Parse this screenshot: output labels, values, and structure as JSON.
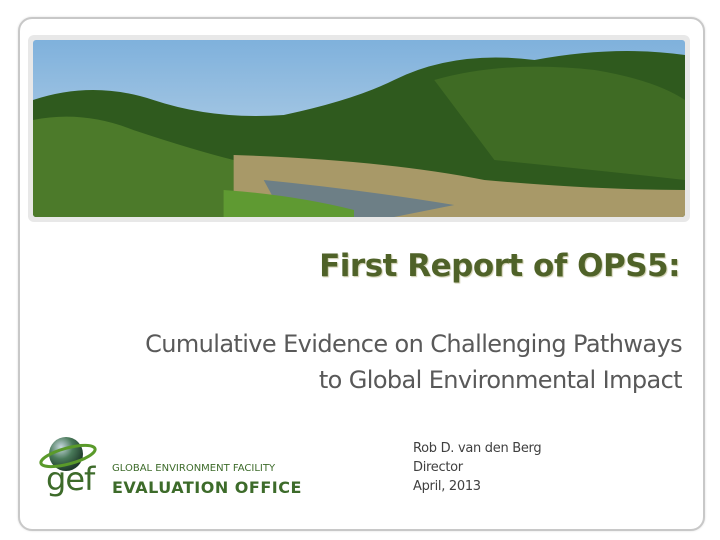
{
  "slide": {
    "title": "First Report of OPS5:",
    "subtitle_line1": "Cumulative Evidence on Challenging Pathways",
    "subtitle_line2": "to Global Environmental Impact",
    "presenter": {
      "name": "Rob D. van den Berg",
      "role": "Director",
      "date": "April, 2013"
    },
    "logo": {
      "mark": "gef",
      "line1": "GLOBAL ENVIRONMENT FACILITY",
      "line2": "EVALUATION OFFICE"
    },
    "colors": {
      "title": "#4f6228",
      "logo_green": "#3d6b2a",
      "subtitle": "#595959"
    }
  }
}
